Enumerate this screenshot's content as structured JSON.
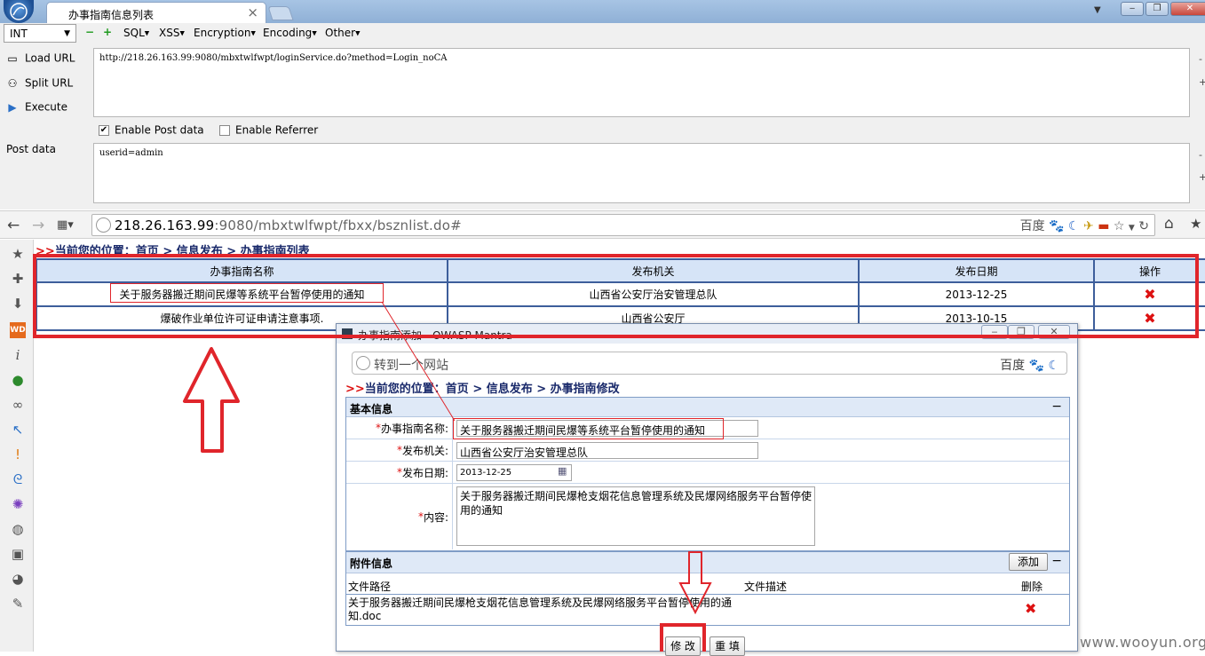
{
  "browser": {
    "tab_title": "办事指南信息列表",
    "tab_close": "×",
    "url_host": "218.26.163.99",
    "url_rest": ":9080/mbxtwlfwpt/fbxx/bsznlist.do#",
    "search_engine": "百度",
    "window_buttons": [
      "‒",
      "❐",
      "✕"
    ]
  },
  "hackbar": {
    "type_select": "INT",
    "menus": [
      "SQL",
      "XSS",
      "Encryption",
      "Encoding",
      "Other"
    ],
    "load_url": "Load URL",
    "split_url": "Split URL",
    "execute": "Execute",
    "url_value": "http://218.26.163.99:9080/mbxtwlfwpt/loginService.do?method=Login_noCA",
    "enable_post": "Enable Post data",
    "enable_referrer": "Enable Referrer",
    "post_label": "Post data",
    "post_value": "userid=admin",
    "enable_post_checked": true,
    "enable_referrer_checked": false
  },
  "page": {
    "breadcrumb_prefix": ">>",
    "breadcrumb": "当前您的位置：首页 > 信息发布 > 办事指南列表",
    "table": {
      "headers": [
        "办事指南名称",
        "发布机关",
        "发布日期",
        "操作"
      ],
      "rows": [
        {
          "name": "关于服务器搬迁期间民爆等系统平台暂停使用的通知",
          "org": "山西省公安厅治安管理总队",
          "date": "2013-12-25",
          "action": "✖"
        },
        {
          "name": "爆破作业单位许可证申请注意事项.",
          "org": "山西省公安厅",
          "date": "2013-10-15",
          "action": "✖"
        }
      ]
    }
  },
  "popup": {
    "title": "办事指南添加 - OWASP Mantra",
    "address_placeholder": "转到一个网站",
    "search_engine": "百度",
    "breadcrumb_prefix": ">>",
    "breadcrumb": "当前您的位置：首页 > 信息发布 > 办事指南修改",
    "basic_section": "基本信息",
    "collapse": "−",
    "fields": {
      "name_label": "办事指南名称:",
      "name_value": "关于服务器搬迁期间民爆等系统平台暂停使用的通知",
      "org_label": "发布机关:",
      "org_value": "山西省公安厅治安管理总队",
      "date_label": "发布日期:",
      "date_value": "2013-12-25",
      "content_label": "内容:",
      "content_value": "关于服务器搬迁期间民爆枪支烟花信息管理系统及民爆网络服务平台暂停使用的通知",
      "required_mark": "*"
    },
    "attach_section": "附件信息",
    "add_button": "添加",
    "attach_headers": [
      "文件路径",
      "文件描述",
      "删除"
    ],
    "attach_rows": [
      {
        "path": "关于服务器搬迁期间民爆枪支烟花信息管理系统及民爆网络服务平台暂停使用的通知.doc",
        "desc": "",
        "del": "✖"
      }
    ],
    "submit_button": "修 改",
    "reset_button": "重 填"
  },
  "watermark": "www.wooyun.org"
}
